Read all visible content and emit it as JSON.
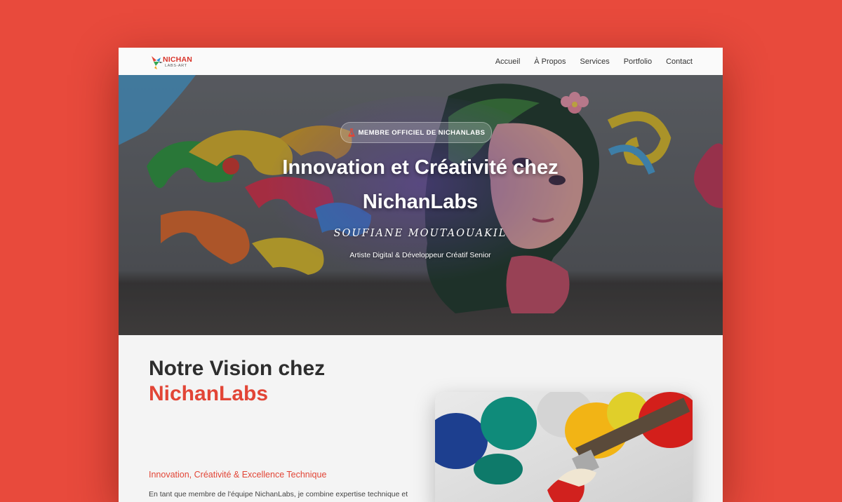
{
  "nav": {
    "logo": {
      "brand": "NICHAN",
      "sub": "LABS-ART"
    },
    "items": [
      "Accueil",
      "À Propos",
      "Services",
      "Portfolio",
      "Contact"
    ]
  },
  "hero": {
    "badge": "MEMBRE OFFICIEL DE NICHANLABS",
    "title": "Innovation et Créativité chez NichanLabs",
    "author": "SOUFIANE MOUTAOUAKIL",
    "role": "Artiste Digital & Développeur Créatif Senior"
  },
  "vision": {
    "title_line1": "Notre Vision chez",
    "title_line2": "NichanLabs",
    "tagline": "Innovation, Créativité & Excellence Technique",
    "paragraph": "En tant que membre de l'équipe NichanLabs, je combine expertise technique et"
  },
  "colors": {
    "page_bg": "#e84a3c",
    "accent": "#e24536",
    "heading": "#2d2d2d"
  },
  "icons": {
    "badge": "flask-icon",
    "logo": "hummingbird-icon"
  }
}
